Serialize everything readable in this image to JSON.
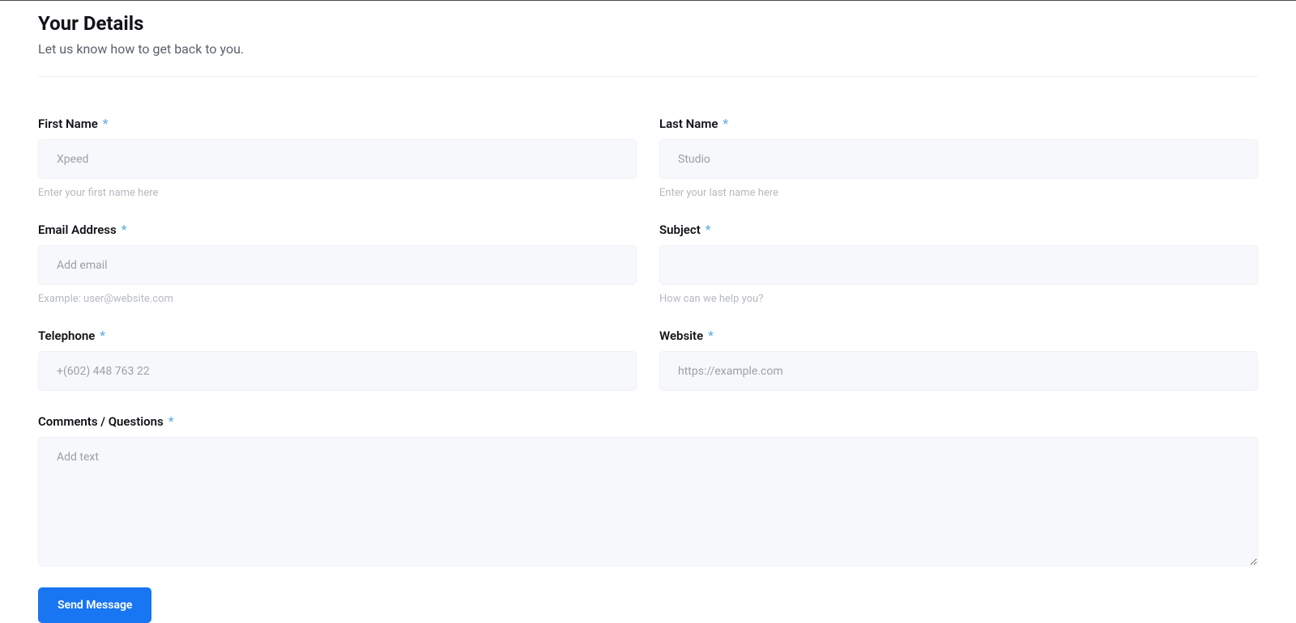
{
  "header": {
    "title": "Your Details",
    "subtitle": "Let us know how to get back to you."
  },
  "fields": {
    "first_name": {
      "label": "First Name",
      "required": "*",
      "placeholder": "Xpeed",
      "hint": "Enter your first name here"
    },
    "last_name": {
      "label": "Last Name",
      "required": "*",
      "placeholder": "Studio",
      "hint": "Enter your last name here"
    },
    "email": {
      "label": "Email Address",
      "required": "*",
      "placeholder": "Add email",
      "hint": "Example: user@website.com"
    },
    "subject": {
      "label": "Subject",
      "required": "*",
      "placeholder": "",
      "hint": "How can we help you?"
    },
    "telephone": {
      "label": "Telephone",
      "required": "*",
      "placeholder": "+(602) 448 763 22"
    },
    "website": {
      "label": "Website",
      "required": "*",
      "placeholder": "https://example.com"
    },
    "comments": {
      "label": "Comments / Questions",
      "required": "*",
      "placeholder": "Add text"
    }
  },
  "submit": {
    "label": "Send Message"
  }
}
